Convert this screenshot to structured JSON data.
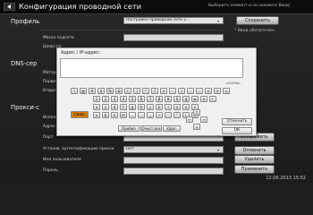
{
  "window": {
    "title": "Конфигурация проводной сети"
  },
  "hint": "Выберите элемент и на   нажмите Ввод/",
  "profile": {
    "label": "Профиль",
    "value": "Настройка проводной сети 2...",
    "save": "Сохранить",
    "note": "* Ввод обязателен"
  },
  "labels": {
    "subnet_mask": "Маска подсети",
    "gateway": "Шлюз по",
    "dns": "DNS-сер",
    "method": "Метод",
    "primary": "Первич",
    "secondary": "Вторич",
    "proxy": "Прокси-с",
    "use": "Использ",
    "address": "Адрес (",
    "port": "Порт",
    "auth": "Установ. аутентификацию прокси",
    "username": "Имя пользователя",
    "password": "Пароль"
  },
  "fields": {
    "auth_value": "Нет"
  },
  "side_buttons": {
    "install": "Установить",
    "cancel": "Отменить",
    "delete": "Удалить",
    "apply": "Применить"
  },
  "dialog": {
    "title": "Адрес / IP-адрес:",
    "input_value": "",
    "counter": "<0/256>",
    "caps": "Симв.",
    "space": "Пробел",
    "clear": "Очист.все",
    "delete": "Удал.",
    "cancel": "Отменить",
    "ok": "ОК",
    "keys_row1": [
      "!",
      "@",
      "#",
      "$",
      "%",
      "&",
      "(",
      ")",
      "*",
      "?",
      "+",
      "-",
      "/",
      ":",
      ";",
      "<",
      ">",
      "="
    ],
    "keys_row2": [
      "1",
      "2",
      "3",
      "4",
      "5",
      "6",
      "7",
      "8",
      "9",
      "0",
      "q",
      "w",
      "e",
      "r"
    ],
    "keys_row3": [
      "a",
      "s",
      "d",
      "f",
      "g",
      "h",
      "j",
      "k",
      "l",
      "z",
      "x",
      "c"
    ],
    "keys_row4": [
      "v",
      "b",
      "n",
      "m",
      ".",
      ",",
      "_",
      "~",
      "'",
      "\"",
      "[",
      "]"
    ]
  },
  "status": {
    "datetime": "12.06.2013 15:52"
  }
}
